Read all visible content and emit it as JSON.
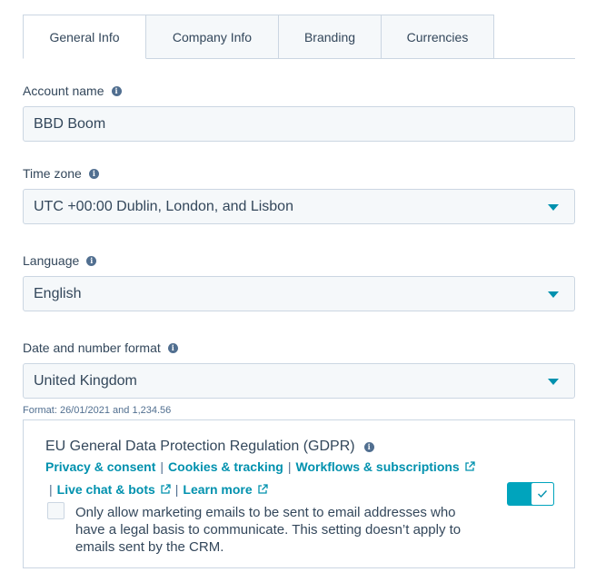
{
  "tabs": [
    {
      "label": "General Info",
      "active": true
    },
    {
      "label": "Company Info",
      "active": false
    },
    {
      "label": "Branding",
      "active": false
    },
    {
      "label": "Currencies",
      "active": false
    }
  ],
  "account_name": {
    "label": "Account name",
    "value": "BBD Boom"
  },
  "time_zone": {
    "label": "Time zone",
    "value": "UTC +00:00 Dublin, London, and Lisbon"
  },
  "language": {
    "label": "Language",
    "value": "English"
  },
  "date_format": {
    "label": "Date and number format",
    "value": "United Kingdom",
    "hint": "Format: 26/01/2021 and 1,234.56"
  },
  "gdpr": {
    "title": "EU General Data Protection Regulation (GDPR)",
    "links": {
      "privacy": "Privacy & consent",
      "cookies": "Cookies & tracking",
      "workflows": "Workflows & subscriptions",
      "live_chat": "Live chat & bots",
      "learn_more": "Learn more"
    },
    "separator": "|",
    "checkbox_text": "Only allow marketing emails to be sent to email addresses who have a legal basis to communicate. This setting doesn’t apply to emails sent by the CRM.",
    "checkbox_checked": false,
    "toggle_on": true
  },
  "colors": {
    "accent": "#0091ae",
    "toggle": "#00a4bd",
    "text": "#33475b",
    "border": "#cbd6e2",
    "field_bg": "#f5f8fa"
  },
  "icons": {
    "info": "info-icon",
    "external": "external-link-icon",
    "caret": "chevron-down-icon",
    "check": "check-icon"
  }
}
